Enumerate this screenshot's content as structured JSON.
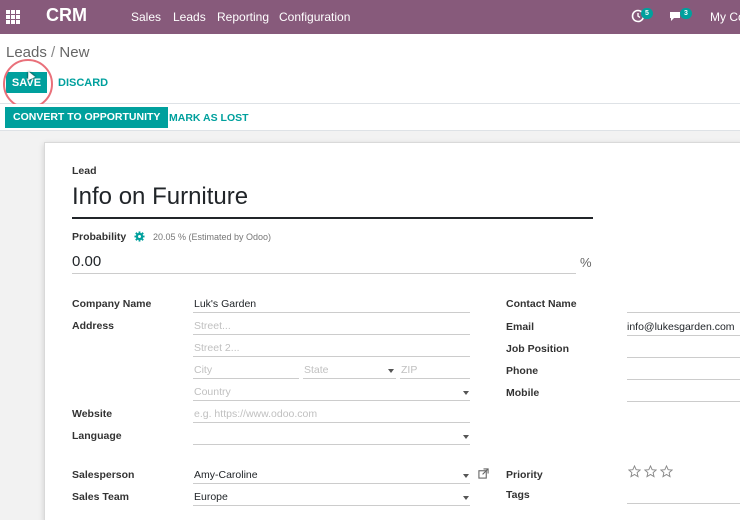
{
  "nav": {
    "brand": "CRM",
    "menu": [
      "Sales",
      "Leads",
      "Reporting",
      "Configuration"
    ],
    "activity_count": "5",
    "message_count": "3",
    "company": "My Co"
  },
  "control_panel": {
    "breadcrumb_root": "Leads",
    "breadcrumb_sep": "/",
    "breadcrumb_current": "New",
    "save_label": "SAVE",
    "discard_label": "DISCARD"
  },
  "statusbar": {
    "convert_label": "CONVERT TO OPPORTUNITY",
    "lost_label": "MARK AS LOST"
  },
  "form": {
    "lead_label": "Lead",
    "title": "Info on Furniture",
    "probability_label": "Probability",
    "probability_estimate": "20.05 % (Estimated by Odoo)",
    "probability_value": "0.00",
    "probability_unit": "%",
    "company_name_label": "Company Name",
    "company_name_value": "Luk's Garden",
    "address_label": "Address",
    "street_placeholder": "Street...",
    "street2_placeholder": "Street 2...",
    "city_placeholder": "City",
    "state_placeholder": "State",
    "zip_placeholder": "ZIP",
    "country_placeholder": "Country",
    "website_label": "Website",
    "website_placeholder": "e.g. https://www.odoo.com",
    "language_label": "Language",
    "salesperson_label": "Salesperson",
    "salesperson_value": "Amy-Caroline",
    "sales_team_label": "Sales Team",
    "sales_team_value": "Europe",
    "contact_name_label": "Contact Name",
    "email_label": "Email",
    "email_value": "info@lukesgarden.com",
    "job_position_label": "Job Position",
    "phone_label": "Phone",
    "mobile_label": "Mobile",
    "priority_label": "Priority",
    "priority_stars": 0,
    "tags_label": "Tags"
  },
  "colors": {
    "navbar": "#875a7b",
    "accent": "#00a09d",
    "highlight": "#e9707a"
  }
}
